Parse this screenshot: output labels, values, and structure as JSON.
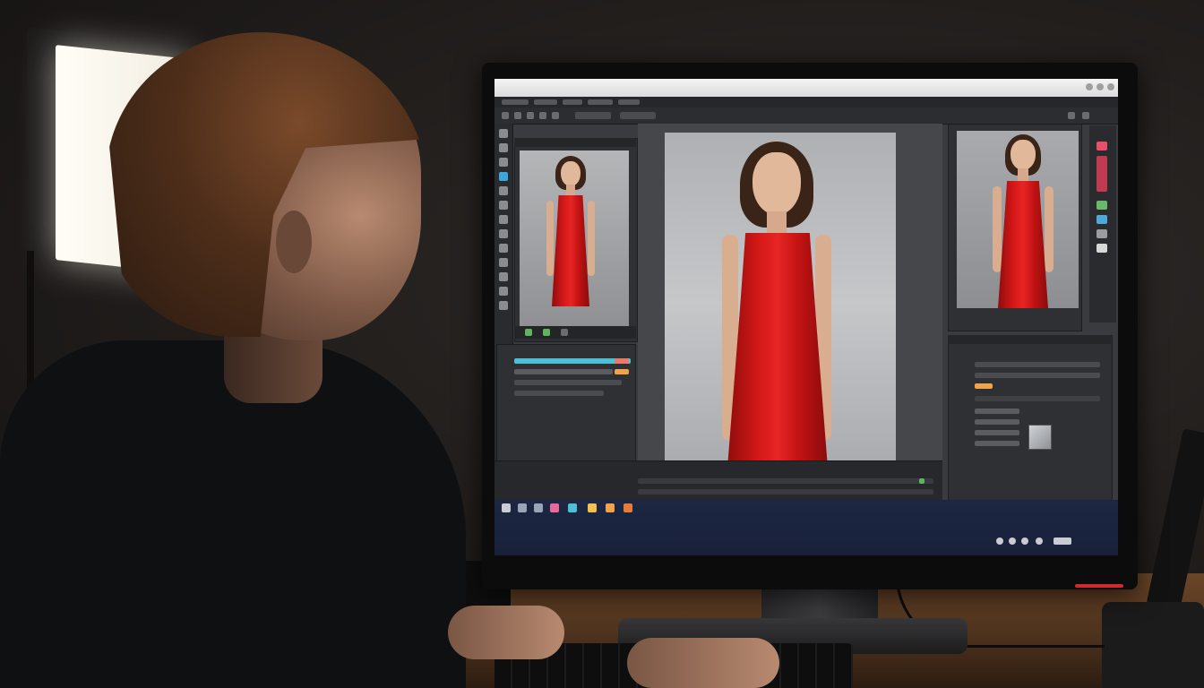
{
  "scene": {
    "description_label": "",
    "colors": {
      "dress": "#d31717",
      "backdrop": "#aeb0b3",
      "ui_dark": "#2f3033",
      "taskbar": "#1e2742"
    }
  },
  "editor": {
    "icons": [
      "move-icon",
      "marquee-icon",
      "lasso-icon",
      "crop-icon",
      "eyedropper-icon",
      "brush-icon",
      "clone-icon",
      "eraser-icon",
      "gradient-icon",
      "pen-icon",
      "text-icon",
      "hand-icon",
      "zoom-icon"
    ]
  }
}
